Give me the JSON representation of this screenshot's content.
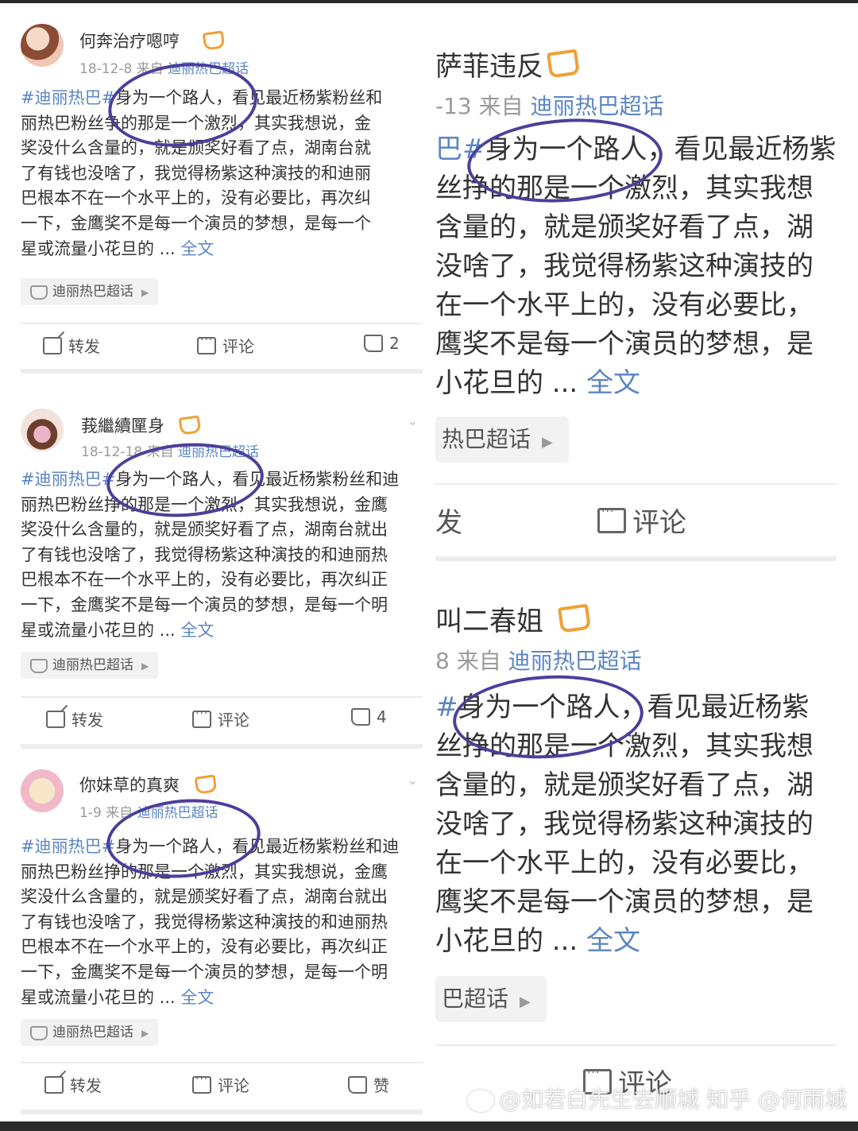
{
  "left_posts": [
    {
      "username": "何奔治疗嗯哼",
      "date": "18-12-8",
      "source_prefix": "来自",
      "source": "迪丽热巴超话",
      "topic": "#迪丽热巴#",
      "lines": [
        "身为一个路人，看见最近杨紫粉丝和",
        "丽热巴粉丝争的那是一个激烈，其实我想说，金",
        "奖没什么含量的，就是颁奖好看了点，湖南台就",
        "了有钱也没啥了，我觉得杨紫这种演技的和迪丽",
        "巴根本不在一个水平上的，没有必要比，再次纠",
        "一下，金鹰奖不是每一个演员的梦想，是每一个",
        "星或流量小花旦的 ... "
      ],
      "full_text": "全文",
      "chip": "迪丽热巴超话",
      "repost": "转发",
      "comment": "评论",
      "like": "2"
    },
    {
      "username": "莪繼續匰身",
      "date": "18-12-18",
      "source_prefix": "来自",
      "source": "迪丽热巴超话",
      "topic": "#迪丽热巴#",
      "lines": [
        "身为一个路人，看见最近杨紫粉丝和迪",
        "丽热巴粉丝挣的那是一个激烈，其实我想说，金鹰",
        "奖没什么含量的，就是颁奖好看了点，湖南台就出",
        "了有钱也没啥了，我觉得杨紫这种演技的和迪丽热",
        "巴根本不在一个水平上的，没有必要比，再次纠正",
        "一下，金鹰奖不是每一个演员的梦想，是每一个明",
        "星或流量小花旦的 ... "
      ],
      "full_text": "全文",
      "chip": "迪丽热巴超话",
      "repost": "转发",
      "comment": "评论",
      "like": "4"
    },
    {
      "username": "你妹草的真爽",
      "date": "1-9",
      "source_prefix": "来自",
      "source": "迪丽热巴超话",
      "topic": "#迪丽热巴#",
      "lines": [
        "身为一个路人，看见最近杨紫粉丝和迪",
        "丽热巴粉丝挣的那是一个激烈，其实我想说，金鹰",
        "奖没什么含量的，就是颁奖好看了点，湖南台就出",
        "了有钱也没啥了，我觉得杨紫这种演技的和迪丽热",
        "巴根本不在一个水平上的，没有必要比，再次纠正",
        "一下，金鹰奖不是每一个演员的梦想，是每一个明",
        "星或流量小花旦的 ... "
      ],
      "full_text": "全文",
      "chip": "迪丽热巴超话",
      "repost": "转发",
      "comment": "评论",
      "like": "赞"
    }
  ],
  "right_posts": [
    {
      "username": "萨菲违反",
      "date": "-13",
      "source_prefix": "来自",
      "source": "迪丽热巴超话",
      "topic": "巴#",
      "lines": [
        "身为一个路人，看见最近杨紫",
        "丝挣的那是一个激烈，其实我想",
        "含量的，就是颁奖好看了点，湖",
        "没啥了，我觉得杨紫这种演技的",
        "在一个水平上的，没有必要比，",
        "鹰奖不是每一个演员的梦想，是",
        "小花旦的 ... "
      ],
      "full_text": "全文",
      "chip": "热巴超话",
      "repost": "发",
      "comment": "评论"
    },
    {
      "username": "叫二春姐",
      "date": "8",
      "source_prefix": "来自",
      "source": "迪丽热巴超话",
      "topic": "#",
      "lines": [
        "身为一个路人，看见最近杨紫",
        "丝挣的那是一个激烈，其实我想",
        "含量的，就是颁奖好看了点，湖",
        "没啥了，我觉得杨紫这种演技的",
        "在一个水平上的，没有必要比，",
        "鹰奖不是每一个演员的梦想，是",
        "小花旦的 ... "
      ],
      "full_text": "全文",
      "chip": "巴超话",
      "repost": "",
      "comment": "评论"
    }
  ],
  "watermark": "知乎 @何雨城",
  "watermark_weibo": "@如若白先生去顺城",
  "colors": {
    "link": "#5b86c4",
    "circle": "#4a3f9c",
    "vip": "#f0a034"
  }
}
